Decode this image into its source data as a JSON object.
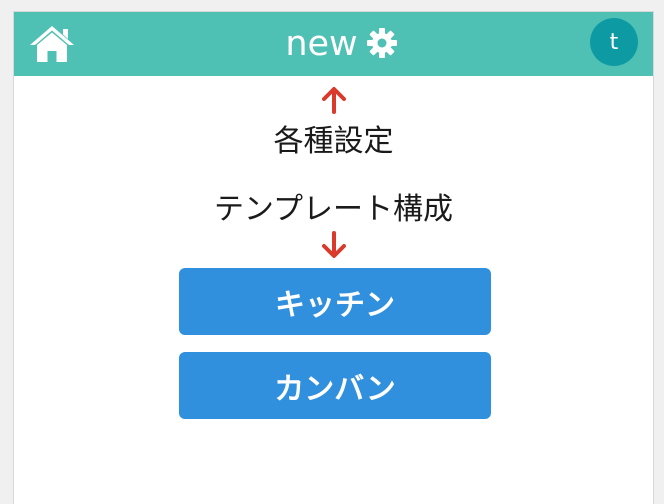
{
  "header": {
    "title": "new",
    "home_icon": "home-icon",
    "settings_icon": "gear-icon",
    "avatar_letter": "t",
    "background_color": "#4fc0b4",
    "avatar_color": "#0e9aa3"
  },
  "main": {
    "settings_label": "各種設定",
    "templates_label": "テンプレート構成",
    "arrow_color": "#d93a2b",
    "templates": [
      {
        "label": "キッチン"
      },
      {
        "label": "カンバン"
      }
    ],
    "button_color": "#3190dd"
  }
}
